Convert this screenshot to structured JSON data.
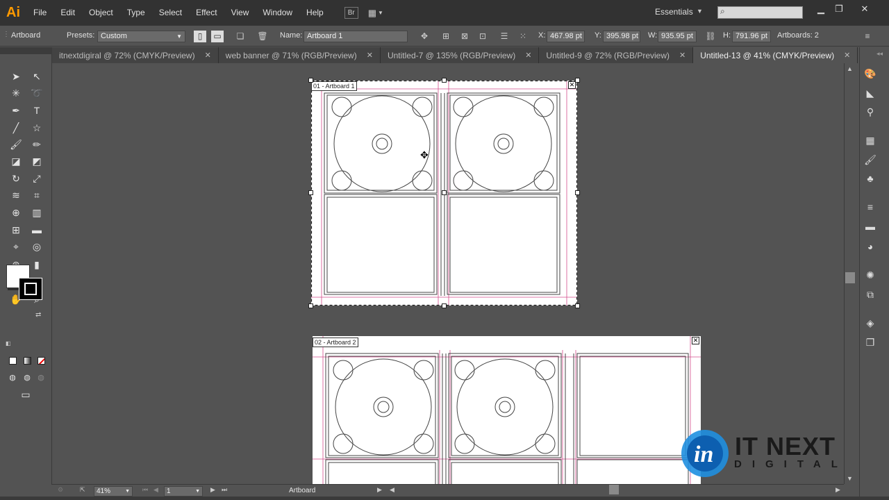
{
  "app": {
    "logo": "Ai",
    "workspace": "Essentials"
  },
  "menu": [
    "File",
    "Edit",
    "Object",
    "Type",
    "Select",
    "Effect",
    "View",
    "Window",
    "Help"
  ],
  "menubar_buttons": {
    "bridge": "Br"
  },
  "control_bar": {
    "tool_label": "Artboard",
    "presets_label": "Presets:",
    "presets_value": "Custom",
    "name_label": "Name:",
    "name_value": "Artboard 1",
    "x_label": "X:",
    "x_value": "467.98 pt",
    "y_label": "Y:",
    "y_value": "395.98 pt",
    "w_label": "W:",
    "w_value": "935.95 pt",
    "h_label": "H:",
    "h_value": "791.96 pt",
    "artboards_count": "Artboards: 2"
  },
  "tabs": [
    {
      "label": "itnextdigiral @ 72% (CMYK/Preview)",
      "active": false
    },
    {
      "label": "web banner @ 71% (RGB/Preview)",
      "active": false
    },
    {
      "label": "Untitled-7 @ 135% (RGB/Preview)",
      "active": false
    },
    {
      "label": "Untitled-9 @ 72% (RGB/Preview)",
      "active": false
    },
    {
      "label": "Untitled-13 @ 41% (CMYK/Preview)",
      "active": true
    }
  ],
  "artboards": [
    {
      "label": "01 - Artboard 1"
    },
    {
      "label": "02 - Artboard 2"
    }
  ],
  "status_bar": {
    "zoom": "41%",
    "artboard_number": "1",
    "status_text": "Artboard"
  },
  "watermark": {
    "line1": "IT NEXT",
    "line2": "DIGITAL",
    "logo_letters": "in"
  },
  "colors": {
    "accent": "#ff9a00",
    "guide": "#d44c8c",
    "canvas": "#535353",
    "chrome": "#323232"
  }
}
